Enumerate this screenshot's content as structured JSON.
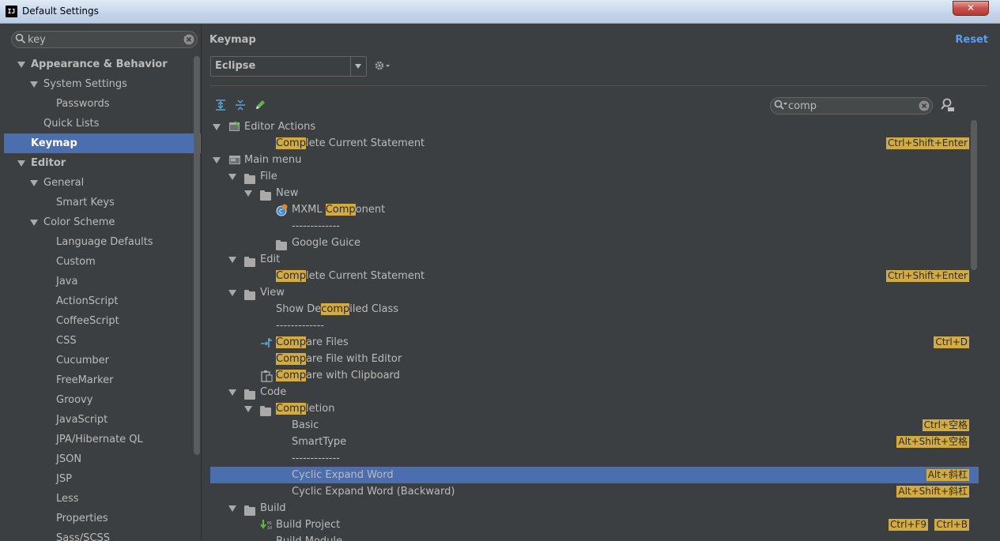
{
  "window": {
    "title": "Default Settings",
    "close": "✕"
  },
  "sidebar": {
    "search_value": "key",
    "items": [
      {
        "label": "Appearance & Behavior",
        "level": 0,
        "arrow": true,
        "bold": true
      },
      {
        "label": "System Settings",
        "level": 1,
        "arrow": true
      },
      {
        "label": "Passwords",
        "level": 2
      },
      {
        "label": "Quick Lists",
        "level": 1
      },
      {
        "label": "Keymap",
        "level": 0,
        "bold": true,
        "selected": true
      },
      {
        "label": "Editor",
        "level": 0,
        "arrow": true,
        "bold": true
      },
      {
        "label": "General",
        "level": 1,
        "arrow": true
      },
      {
        "label": "Smart Keys",
        "level": 2
      },
      {
        "label": "Color Scheme",
        "level": 1,
        "arrow": true
      },
      {
        "label": "Language Defaults",
        "level": 2
      },
      {
        "label": "Custom",
        "level": 2
      },
      {
        "label": "Java",
        "level": 2
      },
      {
        "label": "ActionScript",
        "level": 2
      },
      {
        "label": "CoffeeScript",
        "level": 2
      },
      {
        "label": "CSS",
        "level": 2
      },
      {
        "label": "Cucumber",
        "level": 2
      },
      {
        "label": "FreeMarker",
        "level": 2
      },
      {
        "label": "Groovy",
        "level": 2
      },
      {
        "label": "JavaScript",
        "level": 2
      },
      {
        "label": "JPA/Hibernate QL",
        "level": 2
      },
      {
        "label": "JSON",
        "level": 2
      },
      {
        "label": "JSP",
        "level": 2
      },
      {
        "label": "Less",
        "level": 2
      },
      {
        "label": "Properties",
        "level": 2
      },
      {
        "label": "Sass/SCSS",
        "level": 2
      }
    ]
  },
  "panel": {
    "title": "Keymap",
    "reset_label": "Reset",
    "keymap_value": "Eclipse",
    "filter_value": "comp"
  },
  "tree": [
    {
      "level": 0,
      "arrow": true,
      "icon": "editor-actions-icon",
      "parts": [
        [
          "Editor Actions",
          false
        ]
      ]
    },
    {
      "level": 2,
      "parts": [
        [
          "Comp",
          true
        ],
        [
          "lete Current Statement",
          false
        ]
      ],
      "shortcuts": [
        "Ctrl+Shift+Enter"
      ]
    },
    {
      "level": 0,
      "arrow": true,
      "icon": "main-menu-icon",
      "parts": [
        [
          "Main menu",
          false
        ]
      ]
    },
    {
      "level": 1,
      "arrow": true,
      "icon": "folder-icon",
      "parts": [
        [
          "File",
          false
        ]
      ]
    },
    {
      "level": 2,
      "arrow": true,
      "icon": "folder-icon",
      "parts": [
        [
          "New",
          false
        ]
      ]
    },
    {
      "level": 3,
      "icon": "mxml-component-icon",
      "parts": [
        [
          "MXML ",
          false
        ],
        [
          "Comp",
          true
        ],
        [
          "onent",
          false
        ]
      ]
    },
    {
      "level": 3,
      "parts": [
        [
          "-------------",
          false
        ]
      ]
    },
    {
      "level": 3,
      "icon": "folder-icon",
      "parts": [
        [
          "Google Guice",
          false
        ]
      ]
    },
    {
      "level": 1,
      "arrow": true,
      "icon": "folder-icon",
      "parts": [
        [
          "Edit",
          false
        ]
      ]
    },
    {
      "level": 2,
      "parts": [
        [
          "Comp",
          true
        ],
        [
          "lete Current Statement",
          false
        ]
      ],
      "shortcuts": [
        "Ctrl+Shift+Enter"
      ]
    },
    {
      "level": 1,
      "arrow": true,
      "icon": "folder-icon",
      "parts": [
        [
          "View",
          false
        ]
      ]
    },
    {
      "level": 2,
      "parts": [
        [
          "Show De",
          false
        ],
        [
          "comp",
          true
        ],
        [
          "iled Class",
          false
        ]
      ]
    },
    {
      "level": 2,
      "parts": [
        [
          "-------------",
          false
        ]
      ]
    },
    {
      "level": 2,
      "icon": "compare-files-icon",
      "parts": [
        [
          "Comp",
          true
        ],
        [
          "are Files",
          false
        ]
      ],
      "shortcuts": [
        "Ctrl+D"
      ]
    },
    {
      "level": 2,
      "parts": [
        [
          "Comp",
          true
        ],
        [
          "are File with Editor",
          false
        ]
      ]
    },
    {
      "level": 2,
      "icon": "clipboard-icon",
      "parts": [
        [
          "Comp",
          true
        ],
        [
          "are with Clipboard",
          false
        ]
      ]
    },
    {
      "level": 1,
      "arrow": true,
      "icon": "folder-icon",
      "parts": [
        [
          "Code",
          false
        ]
      ]
    },
    {
      "level": 2,
      "arrow": true,
      "icon": "folder-icon",
      "parts": [
        [
          "Comp",
          true
        ],
        [
          "letion",
          false
        ]
      ]
    },
    {
      "level": 3,
      "parts": [
        [
          "Basic",
          false
        ]
      ],
      "shortcuts": [
        "Ctrl+空格"
      ]
    },
    {
      "level": 3,
      "parts": [
        [
          "SmartType",
          false
        ]
      ],
      "shortcuts": [
        "Alt+Shift+空格"
      ]
    },
    {
      "level": 3,
      "parts": [
        [
          "-------------",
          false
        ]
      ]
    },
    {
      "level": 3,
      "selected": true,
      "parts": [
        [
          "Cyclic Expand Word",
          false
        ]
      ],
      "shortcuts": [
        "Alt+斜杠"
      ]
    },
    {
      "level": 3,
      "parts": [
        [
          "Cyclic Expand Word (Backward)",
          false
        ]
      ],
      "shortcuts": [
        "Alt+Shift+斜杠"
      ]
    },
    {
      "level": 1,
      "arrow": true,
      "icon": "folder-icon",
      "parts": [
        [
          "Build",
          false
        ]
      ]
    },
    {
      "level": 2,
      "icon": "build-project-icon",
      "parts": [
        [
          "Build Project",
          false
        ]
      ],
      "shortcuts": [
        "Ctrl+F9",
        "Ctrl+B"
      ]
    },
    {
      "level": 2,
      "parts": [
        [
          "Build Module",
          false
        ]
      ]
    }
  ],
  "colors": {
    "accent": "#4b6eaf",
    "highlight": "#d4ac3c",
    "link": "#589df6",
    "background": "#3c3f41"
  }
}
